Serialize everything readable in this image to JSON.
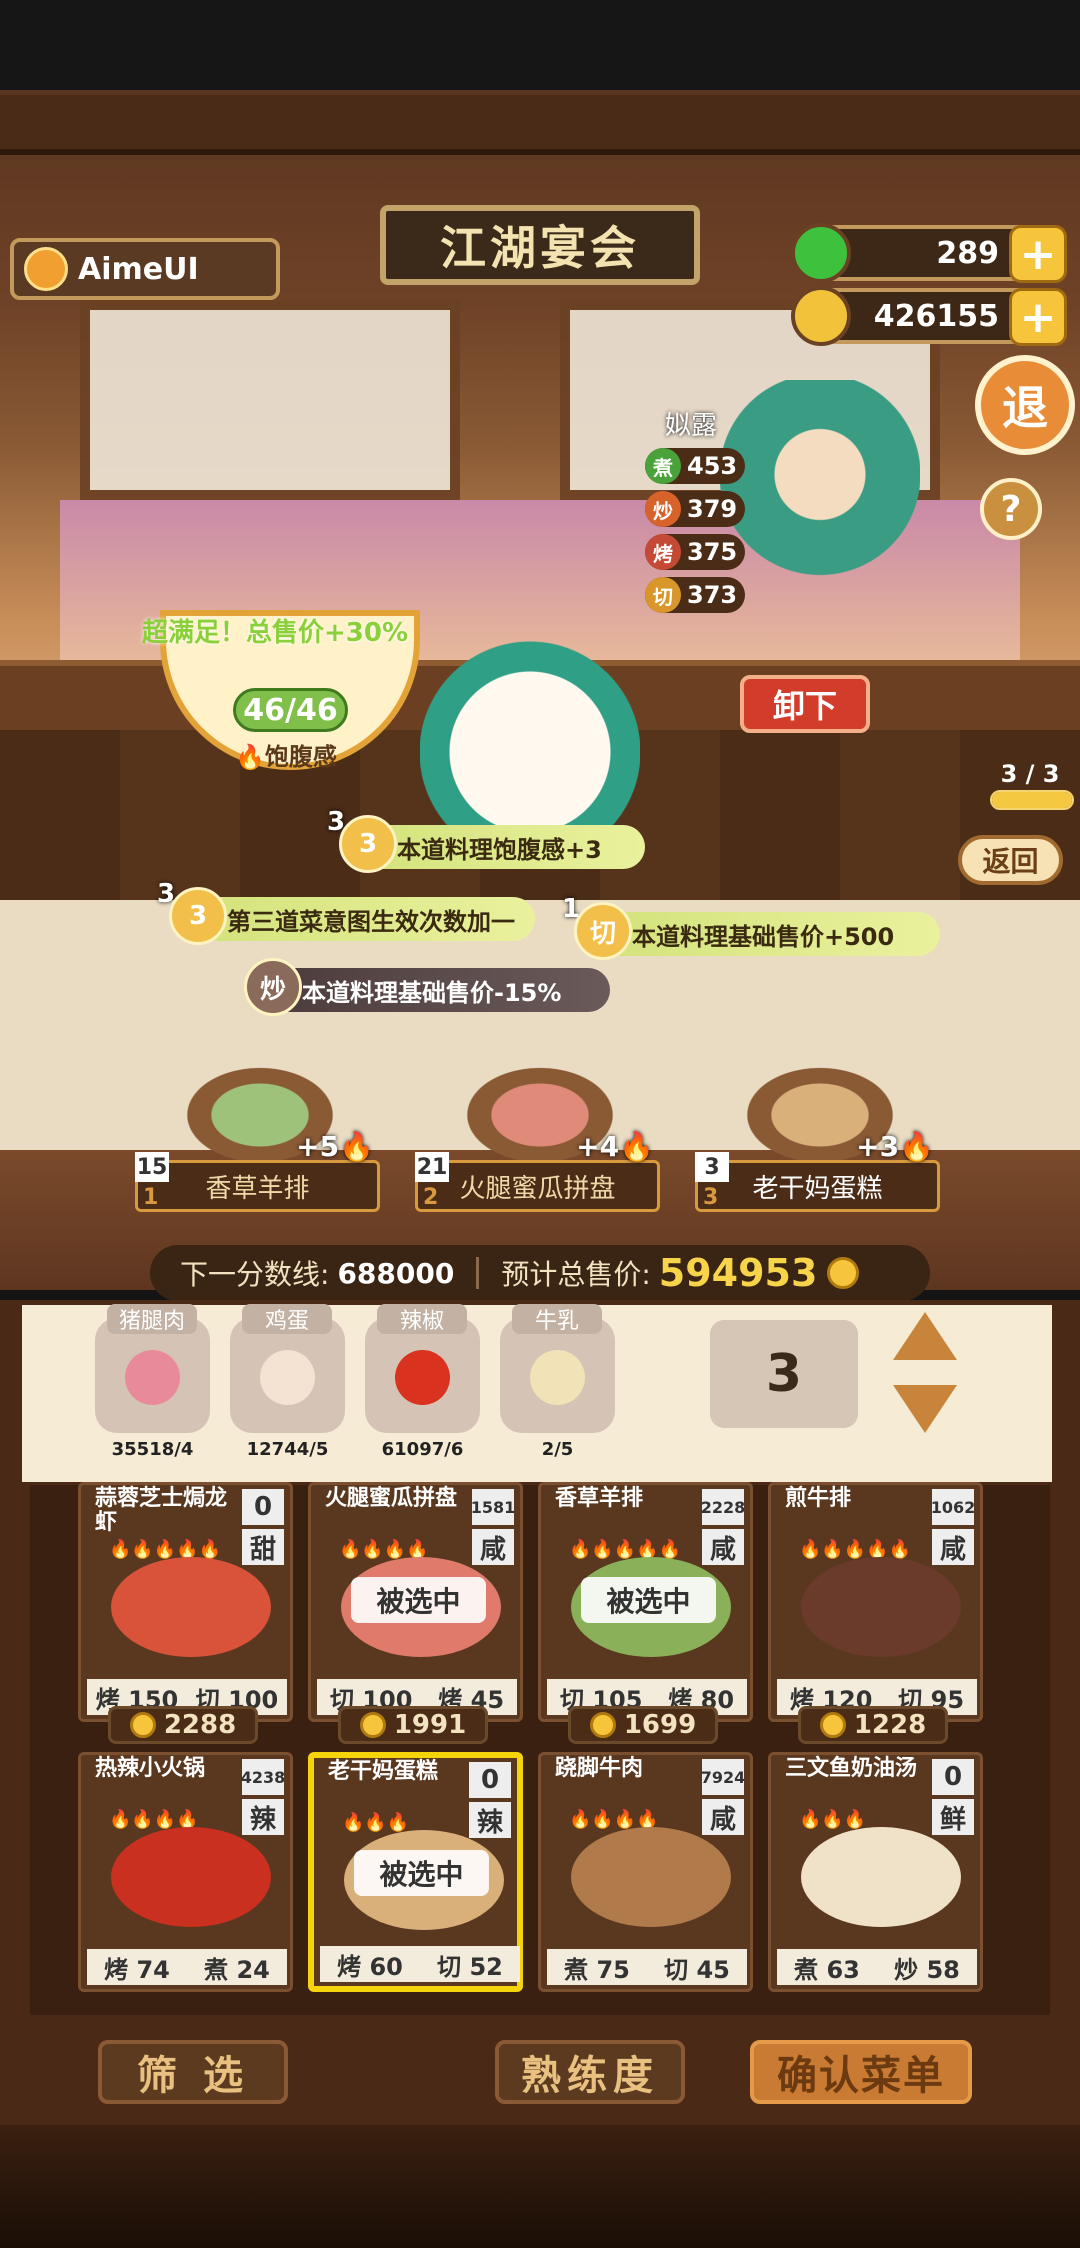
{
  "header": {
    "sign_title": "江湖宴会",
    "player_name": "AimeUI",
    "jade": "289",
    "coins": "426155",
    "plus_label": "+",
    "exit_label": "退",
    "help_label": "?"
  },
  "chef": {
    "name": "姒露",
    "stats": [
      {
        "icon": "煮",
        "value": "453",
        "color": "#4aa33a"
      },
      {
        "icon": "炒",
        "value": "379",
        "color": "#d8632a"
      },
      {
        "icon": "烤",
        "value": "375",
        "color": "#c44a35"
      },
      {
        "icon": "切",
        "value": "373",
        "color": "#d9962a"
      }
    ],
    "remove_label": "卸下"
  },
  "meal": {
    "satisfied_text": "超满足！总售价+30%",
    "fullness": "46/46",
    "fullness_label": "饱腹感",
    "progress": "3 / 3",
    "progress_fraction": 1.0,
    "back_label": "返回"
  },
  "effects": [
    {
      "badge": "3",
      "count": "3",
      "text": "本道料理饱腹感+3",
      "dark": false
    },
    {
      "badge": "3",
      "count": "3",
      "text": "第三道菜意图生效次数加一",
      "dark": false
    },
    {
      "badge": "切",
      "count": "1",
      "text": "本道料理基础售价+500",
      "dark": false
    },
    {
      "badge": "炒",
      "count": "",
      "text": "本道料理基础售价-15%",
      "dark": true
    }
  ],
  "course_dishes": [
    {
      "qty": "15",
      "idx": "1",
      "name": "香草羊排",
      "bonus": "+5"
    },
    {
      "qty": "21",
      "idx": "2",
      "name": "火腿蜜瓜拼盘",
      "bonus": "+4"
    },
    {
      "qty": "3",
      "idx": "3",
      "name": "老干妈蛋糕",
      "bonus": "+3"
    }
  ],
  "score": {
    "next_label": "下一分数线:",
    "next_value": "688000",
    "total_label": "预计总售价:",
    "total_value": "594953"
  },
  "ingredients": [
    {
      "name": "猪腿肉",
      "count": "35518/4",
      "color": "#e98a9a"
    },
    {
      "name": "鸡蛋",
      "count": "12744/5",
      "color": "#f4e2d2"
    },
    {
      "name": "辣椒",
      "count": "61097/6",
      "color": "#d9331f"
    },
    {
      "name": "牛乳",
      "count": "2/5",
      "color": "#f2e2b8"
    }
  ],
  "quantity": "3",
  "recipes": [
    {
      "title": "蒜蓉芝士焗龙虾",
      "rank": "0",
      "taste": "甜",
      "flames": "🔥🔥🔥🔥🔥",
      "s1": "烤",
      "v1": "150",
      "s2": "切",
      "v2": "100",
      "price": "2288",
      "picked": "",
      "color": "#d9533a"
    },
    {
      "title": "火腿蜜瓜拼盘",
      "rank": "1581",
      "taste": "咸",
      "flames": "🔥🔥🔥🔥",
      "s1": "切",
      "v1": "100",
      "s2": "烤",
      "v2": "45",
      "price": "1991",
      "picked": "被选中",
      "color": "#e07a6a"
    },
    {
      "title": "香草羊排",
      "rank": "2228",
      "taste": "咸",
      "flames": "🔥🔥🔥🔥🔥",
      "s1": "切",
      "v1": "105",
      "s2": "烤",
      "v2": "80",
      "price": "1699",
      "picked": "被选中",
      "color": "#8ab05a"
    },
    {
      "title": "煎牛排",
      "rank": "1062",
      "taste": "咸",
      "flames": "🔥🔥🔥🔥🔥",
      "s1": "烤",
      "v1": "120",
      "s2": "切",
      "v2": "95",
      "price": "1228",
      "picked": "",
      "color": "#6a3a2a"
    },
    {
      "title": "热辣小火锅",
      "rank": "4238",
      "taste": "辣",
      "flames": "🔥🔥🔥🔥",
      "s1": "烤",
      "v1": "74",
      "s2": "煮",
      "v2": "24",
      "price": "",
      "picked": "",
      "color": "#c9301f"
    },
    {
      "title": "老干妈蛋糕",
      "rank": "0",
      "taste": "辣",
      "flames": "🔥🔥🔥",
      "s1": "烤",
      "v1": "60",
      "s2": "切",
      "v2": "52",
      "price": "",
      "picked": "被选中",
      "color": "#d9b07a"
    },
    {
      "title": "跷脚牛肉",
      "rank": "7924",
      "taste": "咸",
      "flames": "🔥🔥🔥🔥",
      "s1": "煮",
      "v1": "75",
      "s2": "切",
      "v2": "45",
      "price": "",
      "picked": "",
      "color": "#b07a4a"
    },
    {
      "title": "三文鱼奶油汤",
      "rank": "0",
      "taste": "鲜",
      "flames": "🔥🔥🔥",
      "s1": "煮",
      "v1": "63",
      "s2": "炒",
      "v2": "58",
      "price": "",
      "picked": "",
      "color": "#f0e2c8"
    }
  ],
  "buttons": {
    "filter": "筛 选",
    "proficiency": "熟练度",
    "confirm": "确认菜单"
  }
}
